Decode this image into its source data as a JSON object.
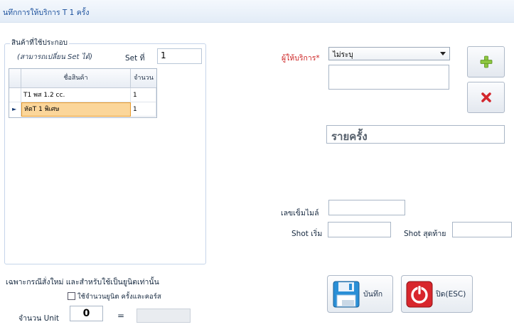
{
  "window": {
    "title": "นทึกการให้บริการ  T 1 ครั้ง"
  },
  "product_group": {
    "legend": "สินค้าที่ใช้ประกอบ",
    "note": "(สามารถเปลี่ยน Set ได้)",
    "set_label": "Set ที่",
    "set_value": "1",
    "table": {
      "columns": [
        "ชื่อสินค้า",
        "จำนวน"
      ],
      "rows": [
        {
          "name": "T1 พส 1.2 cc.",
          "qty": "1",
          "selected": false
        },
        {
          "name": "หัตT 1 พิเศษ",
          "qty": "1",
          "selected": true
        }
      ]
    }
  },
  "provider": {
    "label": "ผู้ให้บริการ*",
    "selected": "ไม่ระบุ",
    "memo": ""
  },
  "buttons": {
    "add_icon": "plus-icon",
    "delete_icon": "x-icon",
    "save_label": "บันทึก",
    "close_label": "ปิด(ESC)"
  },
  "summary_value": "รายครั้ง",
  "fields": {
    "mileage_label": "เลขเข็มไมล์",
    "mileage_value": "",
    "shot_start_label": "Shot เริ่ม",
    "shot_start_value": "",
    "shot_end_label": "Shot สุดท้าย",
    "shot_end_value": ""
  },
  "unit_section": {
    "note": "เฉพาะกรณีสั่งใหม่ และสำหรับใช้เป็นยูนิตเท่านั้น",
    "checkbox_label": "ใช้จำนวนยูนิต ครั้งและคอร์ส",
    "checkbox_checked": false,
    "unit_label": "จำนวน Unit",
    "unit_value": "0",
    "equals": "=",
    "result_value": ""
  },
  "colors": {
    "accent": "#1a4f9c",
    "required": "#cc1f1f",
    "selected_row": "#fbd69a"
  }
}
